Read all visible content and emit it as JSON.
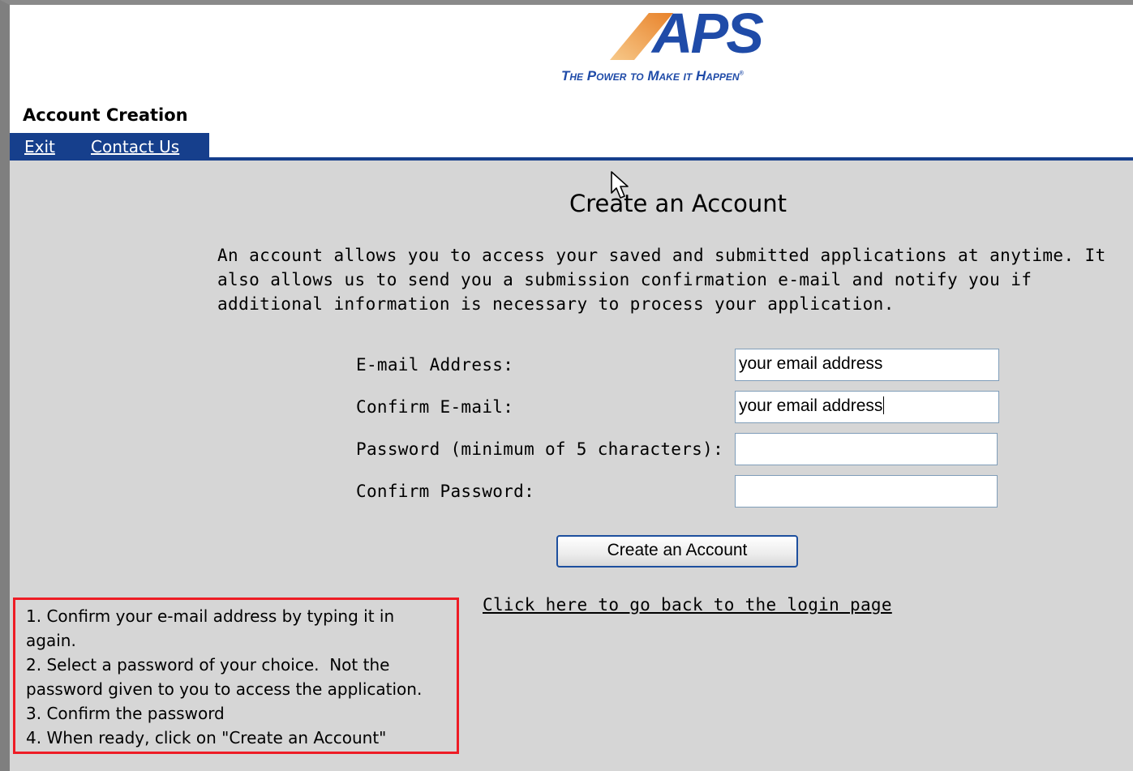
{
  "header": {
    "logo_text": "APS",
    "logo_tagline": "The Power to Make it Happen",
    "section_title": "Account Creation"
  },
  "nav": {
    "exit": "Exit",
    "contact_us": "Contact Us"
  },
  "main": {
    "heading": "Create an Account",
    "intro": "An account allows you to access your saved and submitted applications at anytime. It also allows us to send you a submission confirmation e-mail and notify you if additional information is necessary to process your application."
  },
  "form": {
    "email_label": "E-mail Address:",
    "email_value": "your email address",
    "confirm_email_label": "Confirm E-mail:",
    "confirm_email_value": "your email address",
    "password_label": "Password (minimum of 5 characters):",
    "password_value": "",
    "confirm_password_label": "Confirm Password:",
    "confirm_password_value": "",
    "submit_label": "Create an Account"
  },
  "login_link": "Click here to go back to the login page",
  "instructions": [
    "1. Confirm your e-mail address by typing it in again.",
    "2. Select a password of your choice.  Not the password given to you to access the application.",
    "3. Confirm the password",
    "4. When ready, click on \"Create an Account\""
  ],
  "colors": {
    "brand_blue": "#1f4ba8",
    "nav_blue": "#163f8c",
    "logo_orange": "#f0a04b",
    "content_bg": "#d6d6d6",
    "callout_red": "#ee1c25"
  },
  "icons": {
    "cursor": "mouse-pointer-icon"
  }
}
